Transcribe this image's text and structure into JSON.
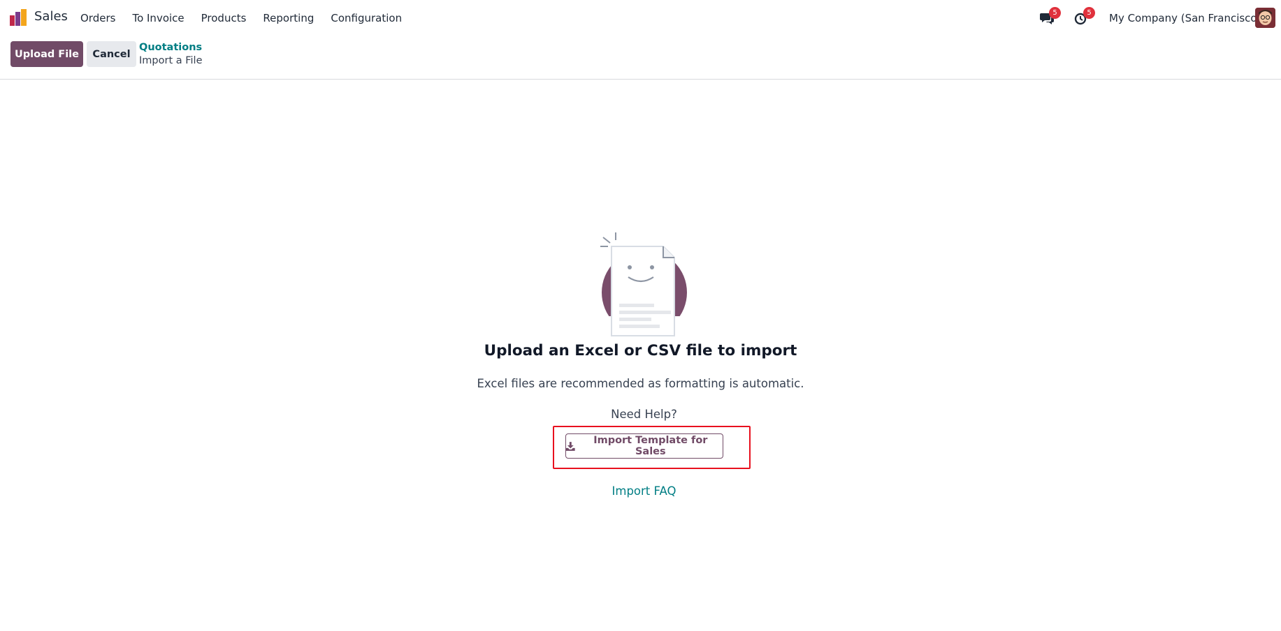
{
  "navbar": {
    "app_name": "Sales",
    "menu": [
      {
        "label": "Orders"
      },
      {
        "label": "To Invoice"
      },
      {
        "label": "Products"
      },
      {
        "label": "Reporting"
      },
      {
        "label": "Configuration"
      }
    ],
    "messages_count": "5",
    "activities_count": "5",
    "company": "My Company (San Francisco)"
  },
  "control_panel": {
    "upload_label": "Upload File",
    "cancel_label": "Cancel",
    "breadcrumb_parent": "Quotations",
    "breadcrumb_current": "Import a File"
  },
  "main": {
    "title": "Upload an Excel or CSV file to import",
    "subtitle": "Excel files are recommended as formatting is automatic.",
    "need_help": "Need Help?",
    "template_button": "Import Template for Sales",
    "faq_link": "Import FAQ"
  },
  "colors": {
    "brand": "#714b67",
    "link": "#017e84",
    "badge": "#e0313c",
    "highlight": "#e8101e"
  },
  "icons": {
    "logo": "sales-app-logo-icon",
    "messages": "chat-bubbles-icon",
    "activities": "clock-icon",
    "download": "download-icon"
  }
}
